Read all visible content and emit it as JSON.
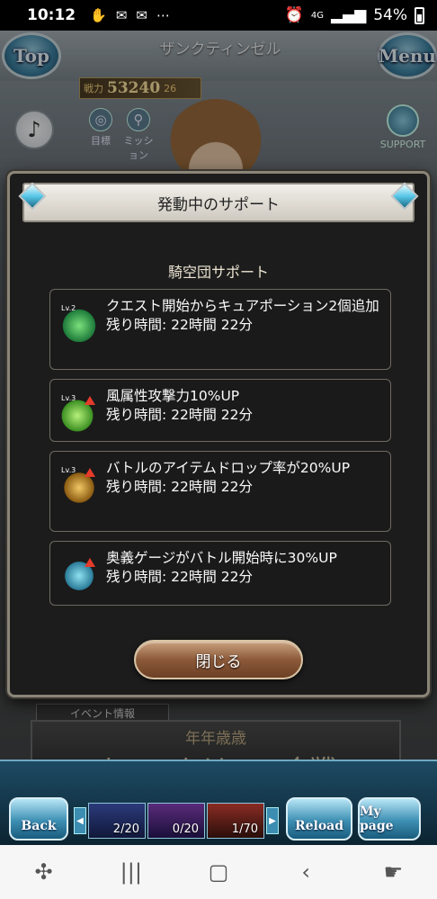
{
  "status_bar": {
    "time": "10:12",
    "icons": [
      "hand-icon",
      "mail-icon",
      "mail-icon",
      "more-icon"
    ],
    "right_text": "54%",
    "network": "4G"
  },
  "game": {
    "top_button": "Top",
    "menu_button": "Menu",
    "location": "ザンクティンゼル",
    "power_label": "戦力",
    "power_value": "53240",
    "power_extra": "26",
    "goal_label": "目標",
    "mission_label": "ミッション",
    "support_label": "SUPPORT",
    "event_label": "イベント情報",
    "event_title_line1": "年年歳歳",
    "event_title_line2": "きのこたけのこ合戦"
  },
  "modal": {
    "title": "発動中のサポート",
    "section_title": "騎空団サポート",
    "cards": [
      {
        "icon": "cure-potion-icon",
        "level": "Lv.2",
        "text": "クエスト開始からキュアポーション2個追加",
        "time": "残り時間: 22時間 22分"
      },
      {
        "icon": "wind-attack-up-icon",
        "level": "Lv.3",
        "text": "風属性攻撃力10%UP",
        "time": "残り時間: 22時間 22分"
      },
      {
        "icon": "item-drop-up-icon",
        "level": "Lv.3",
        "text": "バトルのアイテムドロップ率が20%UP",
        "time": "残り時間: 22時間 22分"
      },
      {
        "icon": "ougi-gauge-icon",
        "level": "",
        "text": "奥義ゲージがバトル開始時に30%UP",
        "time": "残り時間: 22時間 22分"
      }
    ],
    "close_button": "閉じる"
  },
  "footer": {
    "back_button": "Back",
    "reload_button": "Reload",
    "mypage_button": "My page",
    "stamina": [
      {
        "count": "2/20"
      },
      {
        "count": "0/20"
      },
      {
        "count": "1/70"
      }
    ]
  },
  "nav_bar": {
    "icons": [
      "game-launcher-icon",
      "recent-apps-icon",
      "home-icon",
      "back-icon",
      "assistant-icon"
    ]
  }
}
